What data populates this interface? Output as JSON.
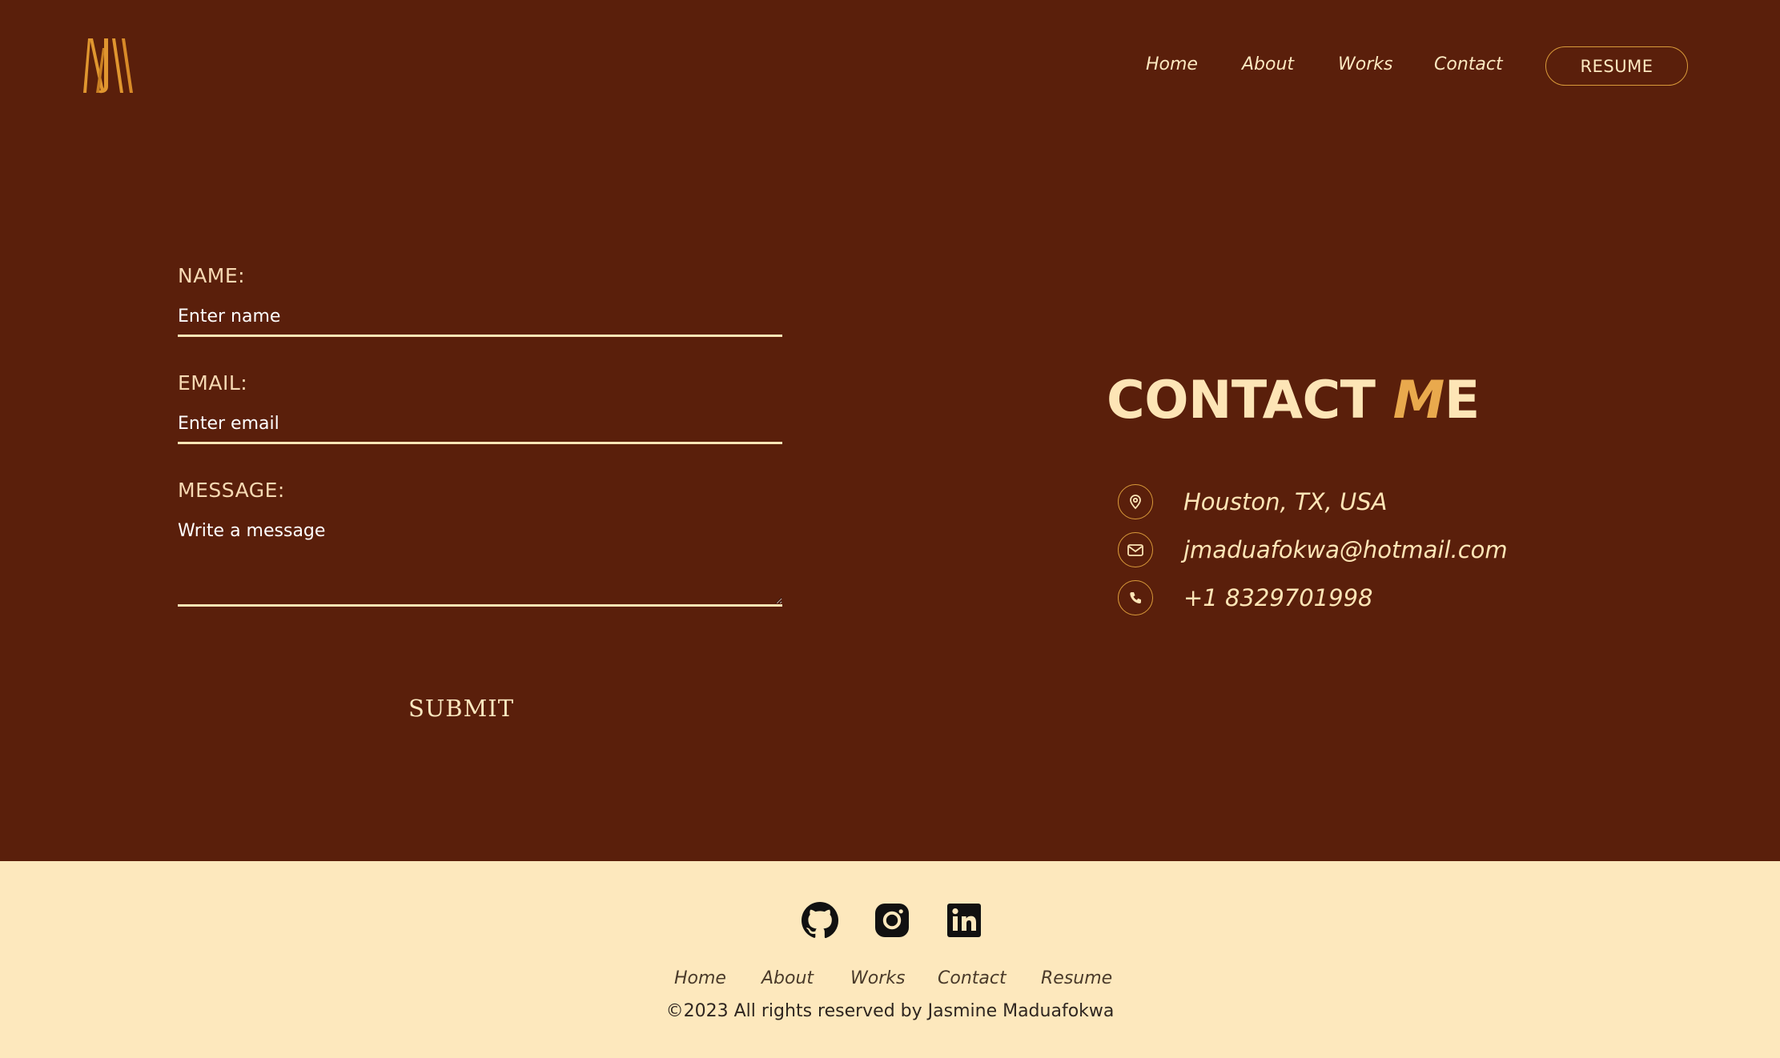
{
  "header": {
    "logo_alt": "NM monogram logo",
    "nav": [
      "Home",
      "About",
      "Works",
      "Contact"
    ],
    "resume_label": "RESUME"
  },
  "form": {
    "name_label": "NAME:",
    "name_placeholder": "Enter name",
    "email_label": "EMAIL:",
    "email_placeholder": "Enter email",
    "message_label": "MESSAGE:",
    "message_placeholder": "Write a message",
    "submit_label": "SUBMIT"
  },
  "contact": {
    "title_main": "CONTACT ",
    "title_accent": "M",
    "title_tail": "E",
    "location": "Houston, TX, USA",
    "email": "jmaduafokwa@hotmail.com",
    "phone": "+1 8329701998"
  },
  "footer": {
    "social": [
      "github-icon",
      "instagram-icon",
      "linkedin-icon"
    ],
    "nav": [
      "Home",
      "About",
      "Works",
      "Contact",
      "Resume"
    ],
    "copyright": "©2023 All rights reserved by Jasmine Maduafokwa"
  },
  "colors": {
    "background": "#5a1f0b",
    "accent": "#d99a3a",
    "cream": "#fde5b6",
    "footer_bg": "#fde8bd"
  }
}
